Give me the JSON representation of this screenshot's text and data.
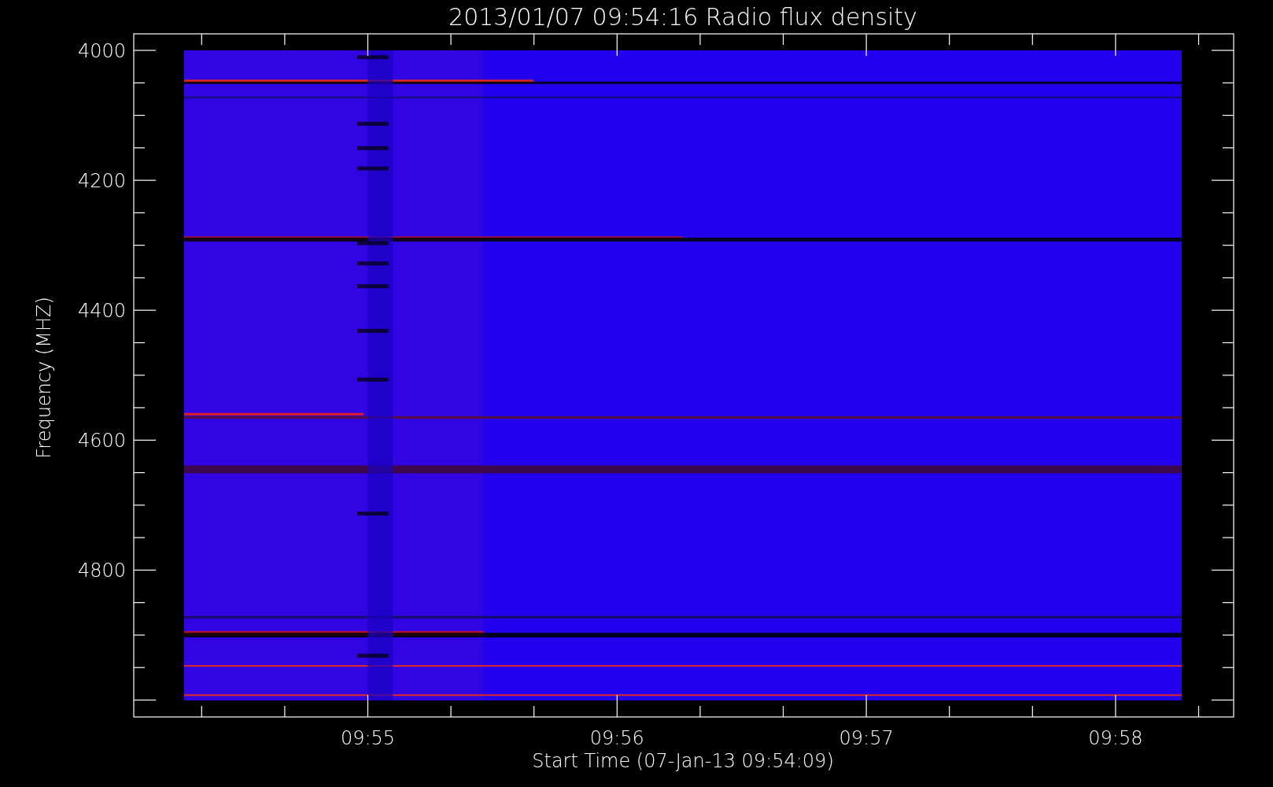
{
  "title": "2013/01/07 09:54:16 Radio flux density",
  "y_axis": {
    "label": "Frequency (MHZ)",
    "ticks": [
      "4000",
      "4200",
      "4400",
      "4600",
      "4800"
    ]
  },
  "x_axis": {
    "label": "Start Time (07-Jan-13 09:54:09)",
    "ticks": [
      "09:55",
      "09:56",
      "09:57",
      "09:58"
    ]
  }
}
